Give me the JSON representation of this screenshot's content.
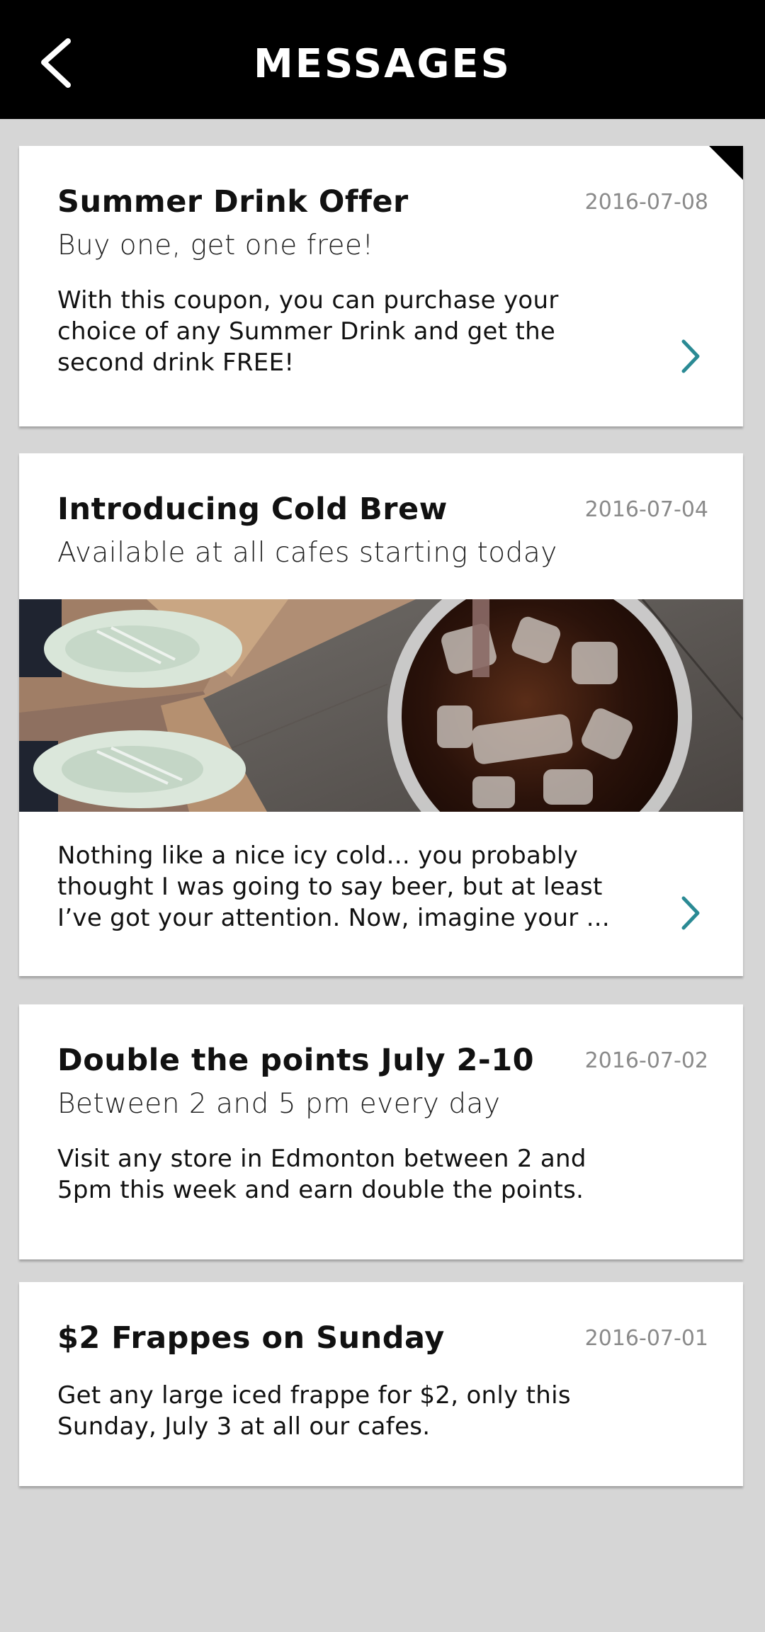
{
  "header": {
    "title": "MESSAGES",
    "back_icon": "chevron-left-icon"
  },
  "colors": {
    "header_bg": "#000000",
    "page_bg": "#d6d6d6",
    "accent_chevron": "#2a8a94",
    "date_text": "#8a8a8a"
  },
  "messages": [
    {
      "title": "Summer Drink Offer",
      "date": "2016-07-08",
      "subtitle": "Buy one, get one free!",
      "body_lines": [
        "With this coupon, you can purchase your",
        "choice of any Summer Drink and get the",
        "second drink FREE!"
      ],
      "unread": true
    },
    {
      "title": "Introducing Cold Brew",
      "date": "2016-07-04",
      "subtitle": "Available at all cafes starting today",
      "body_lines": [
        "Nothing like a nice icy cold... you probably",
        "thought I was going to say beer, but at least",
        "I’ve got your attention. Now, imagine your ..."
      ],
      "image": "iced-cold-brew-photo"
    },
    {
      "title": "Double the points July 2-10",
      "date": "2016-07-02",
      "subtitle": "Between 2 and 5 pm every day",
      "body_lines": [
        "Visit any store in Edmonton between 2 and",
        "5pm this week and earn double the points."
      ]
    },
    {
      "title": "$2 Frappes on Sunday",
      "date": "2016-07-01",
      "body_lines": [
        "Get any large iced frappe for $2, only this",
        "Sunday, July 3 at all our cafes."
      ]
    }
  ]
}
